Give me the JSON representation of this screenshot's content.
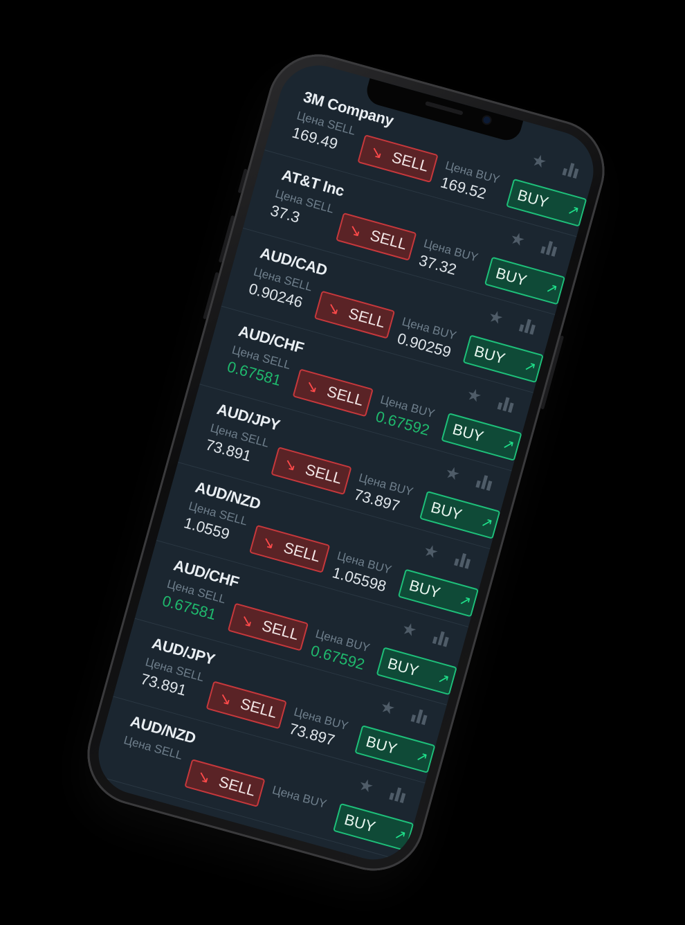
{
  "colors": {
    "background": "#000000",
    "screen": "#1b2630",
    "sell": "#c7383c",
    "buy": "#1ec07a",
    "price_up": "#1fb96d"
  },
  "labels": {
    "sell_caption": "Цена SELL",
    "buy_caption": "Цена BUY",
    "sell_button": "SELL",
    "buy_button": "BUY"
  },
  "icons": {
    "sell_arrow": "↘",
    "buy_arrow": "↗",
    "favorite": "★",
    "chart": "bar-chart-icon"
  },
  "instruments": [
    {
      "name": "3M Company",
      "sell_price": "169.49",
      "buy_price": "169.52",
      "trend": "none"
    },
    {
      "name": "AT&T Inc",
      "sell_price": "37.3",
      "buy_price": "37.32",
      "trend": "none"
    },
    {
      "name": "AUD/CAD",
      "sell_price": "0.90246",
      "buy_price": "0.90259",
      "trend": "none"
    },
    {
      "name": "AUD/CHF",
      "sell_price": "0.67581",
      "buy_price": "0.67592",
      "trend": "up"
    },
    {
      "name": "AUD/JPY",
      "sell_price": "73.891",
      "buy_price": "73.897",
      "trend": "none"
    },
    {
      "name": "AUD/NZD",
      "sell_price": "1.0559",
      "buy_price": "1.05598",
      "trend": "none"
    },
    {
      "name": "AUD/CHF",
      "sell_price": "0.67581",
      "buy_price": "0.67592",
      "trend": "up"
    },
    {
      "name": "AUD/JPY",
      "sell_price": "73.891",
      "buy_price": "73.897",
      "trend": "none"
    },
    {
      "name": "AUD/NZD",
      "sell_price": "",
      "buy_price": "",
      "trend": "none"
    }
  ]
}
